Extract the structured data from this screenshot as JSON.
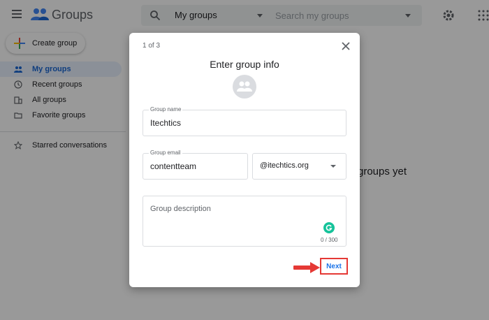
{
  "header": {
    "app_name": "Groups",
    "search_scope": "My groups",
    "search_placeholder": "Search my groups"
  },
  "sidebar": {
    "create_label": "Create group",
    "items": [
      {
        "label": "My groups",
        "icon": "people-icon",
        "active": true
      },
      {
        "label": "Recent groups",
        "icon": "clock-icon"
      },
      {
        "label": "All groups",
        "icon": "building-icon"
      },
      {
        "label": "Favorite groups",
        "icon": "folder-star-icon"
      }
    ],
    "starred_label": "Starred conversations"
  },
  "main": {
    "empty_text": "groups yet"
  },
  "dialog": {
    "step": "1 of 3",
    "title": "Enter group info",
    "group_name_label": "Group name",
    "group_name_value": "Itechtics",
    "group_email_label": "Group email",
    "group_email_value": "contentteam",
    "domain_value": "@itechtics.org",
    "description_placeholder": "Group description",
    "char_counter": "0 / 300",
    "next_label": "Next"
  },
  "colors": {
    "accent": "#1a73e8",
    "highlight_box": "#e53935",
    "grammarly": "#15c39a"
  }
}
